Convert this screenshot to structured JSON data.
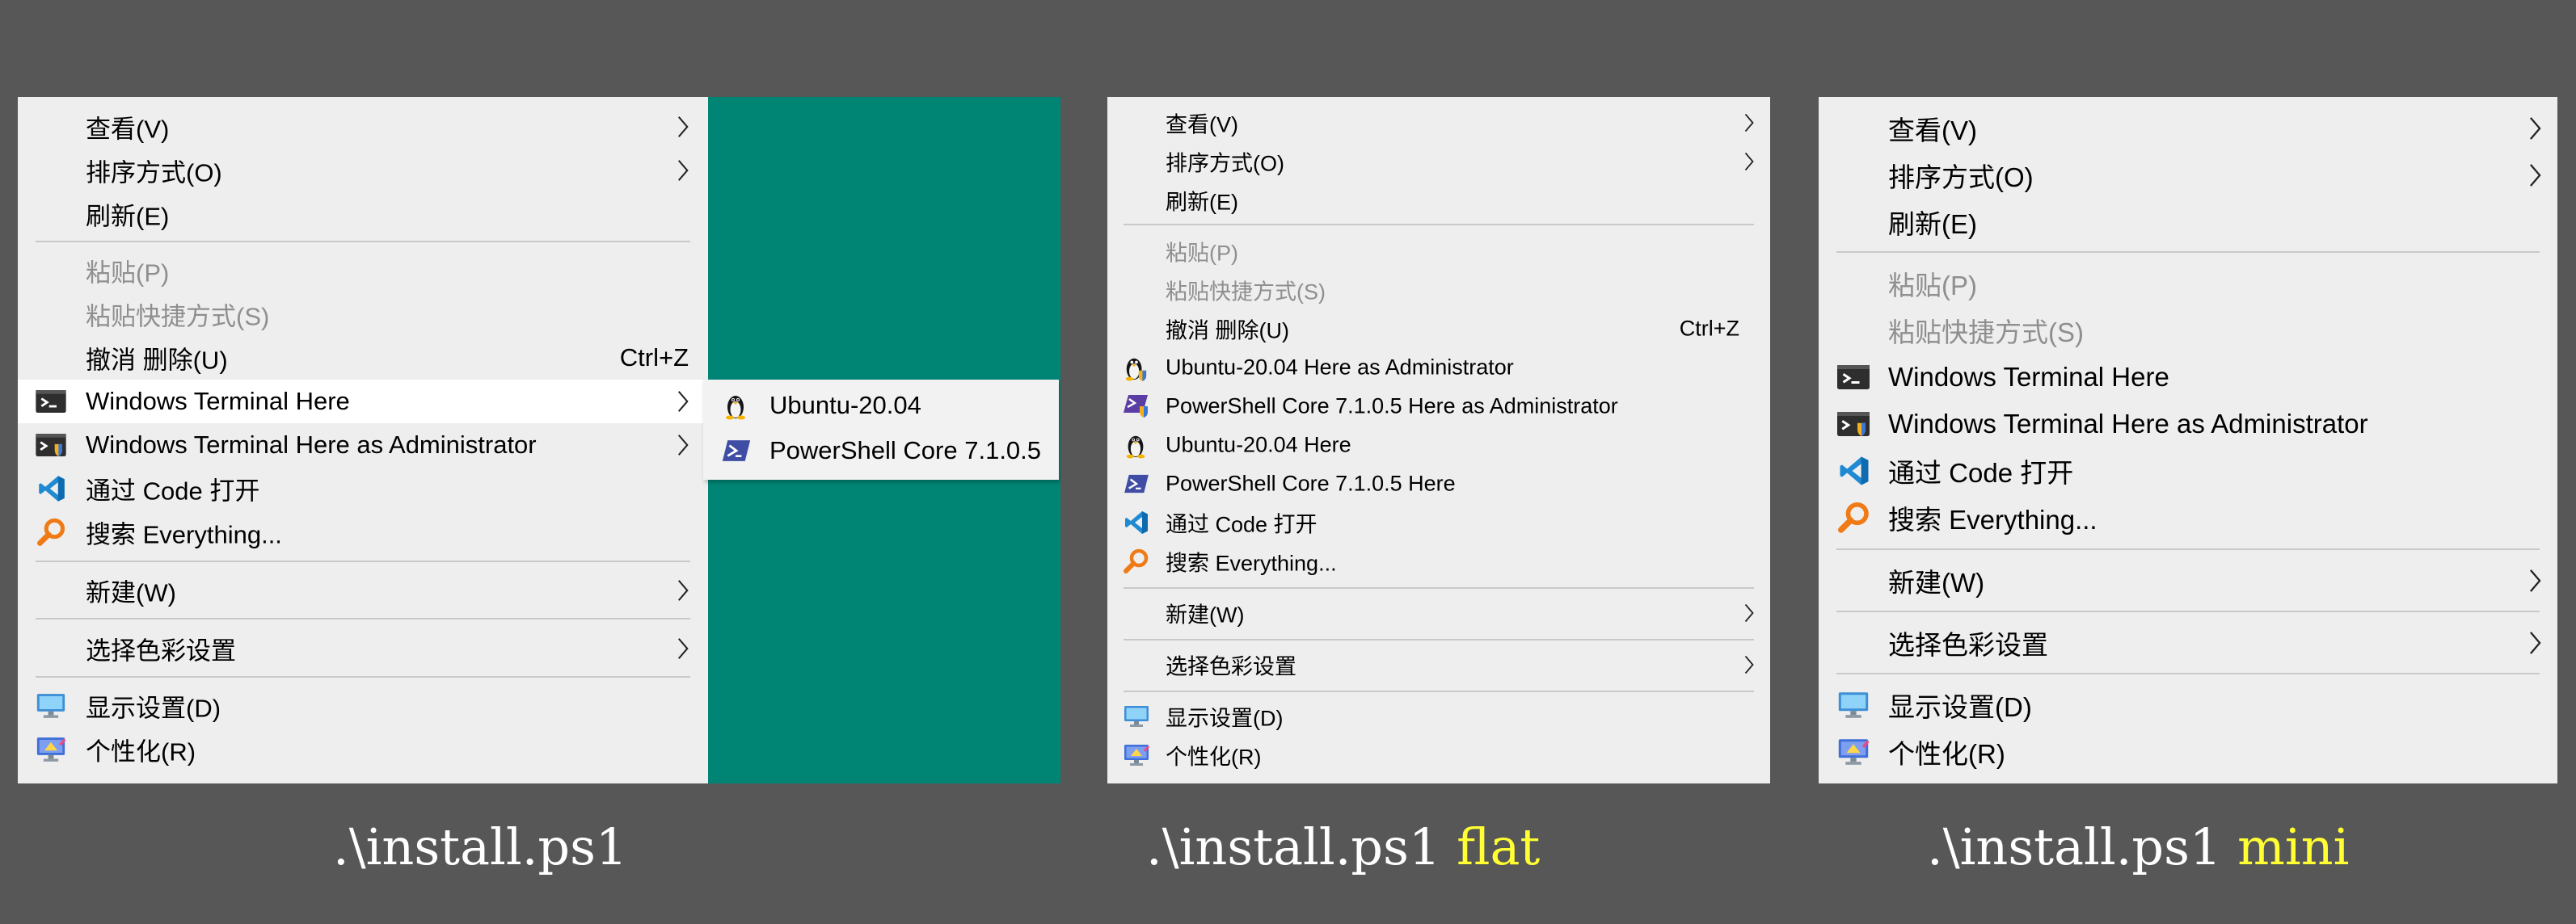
{
  "colors": {
    "background": "#575757",
    "menu": "#eeeeee",
    "desktop": "#008575",
    "arg_highlight": "#ffff33"
  },
  "panel1": {
    "caption": {
      "cmd": ".\\install.ps1",
      "arg": ""
    },
    "items": {
      "view": "查看(V)",
      "sort": "排序方式(O)",
      "refresh": "刷新(E)",
      "paste": "粘贴(P)",
      "paste_shortcut": "粘贴快捷方式(S)",
      "undo": "撤消 删除(U)",
      "undo_shortcut": "Ctrl+Z",
      "terminal_here": "Windows Terminal Here",
      "terminal_admin": "Windows Terminal Here as Administrator",
      "code_open": "通过 Code 打开",
      "search_everything": "搜索 Everything...",
      "new": "新建(W)",
      "color": "选择色彩设置",
      "display": "显示设置(D)",
      "personalize": "个性化(R)"
    },
    "submenu": {
      "ubuntu": "Ubuntu-20.04",
      "powershell": "PowerShell Core 7.1.0.5"
    }
  },
  "panel2": {
    "caption": {
      "cmd": ".\\install.ps1",
      "arg": "flat"
    },
    "items": {
      "view": "查看(V)",
      "sort": "排序方式(O)",
      "refresh": "刷新(E)",
      "paste": "粘贴(P)",
      "paste_shortcut": "粘贴快捷方式(S)",
      "undo": "撤消 删除(U)",
      "undo_shortcut": "Ctrl+Z",
      "ubuntu_admin": "Ubuntu-20.04 Here as Administrator",
      "powershell_admin": "PowerShell Core 7.1.0.5 Here as Administrator",
      "ubuntu_here": "Ubuntu-20.04 Here",
      "powershell_here": "PowerShell Core 7.1.0.5 Here",
      "code_open": "通过 Code 打开",
      "search_everything": "搜索 Everything...",
      "new": "新建(W)",
      "color": "选择色彩设置",
      "display": "显示设置(D)",
      "personalize": "个性化(R)"
    }
  },
  "panel3": {
    "caption": {
      "cmd": ".\\install.ps1",
      "arg": "mini"
    },
    "items": {
      "view": "查看(V)",
      "sort": "排序方式(O)",
      "refresh": "刷新(E)",
      "paste": "粘贴(P)",
      "paste_shortcut": "粘贴快捷方式(S)",
      "terminal_here": "Windows Terminal Here",
      "terminal_admin": "Windows Terminal Here as Administrator",
      "code_open": "通过 Code 打开",
      "search_everything": "搜索 Everything...",
      "new": "新建(W)",
      "color": "选择色彩设置",
      "display": "显示设置(D)",
      "personalize": "个性化(R)"
    }
  }
}
